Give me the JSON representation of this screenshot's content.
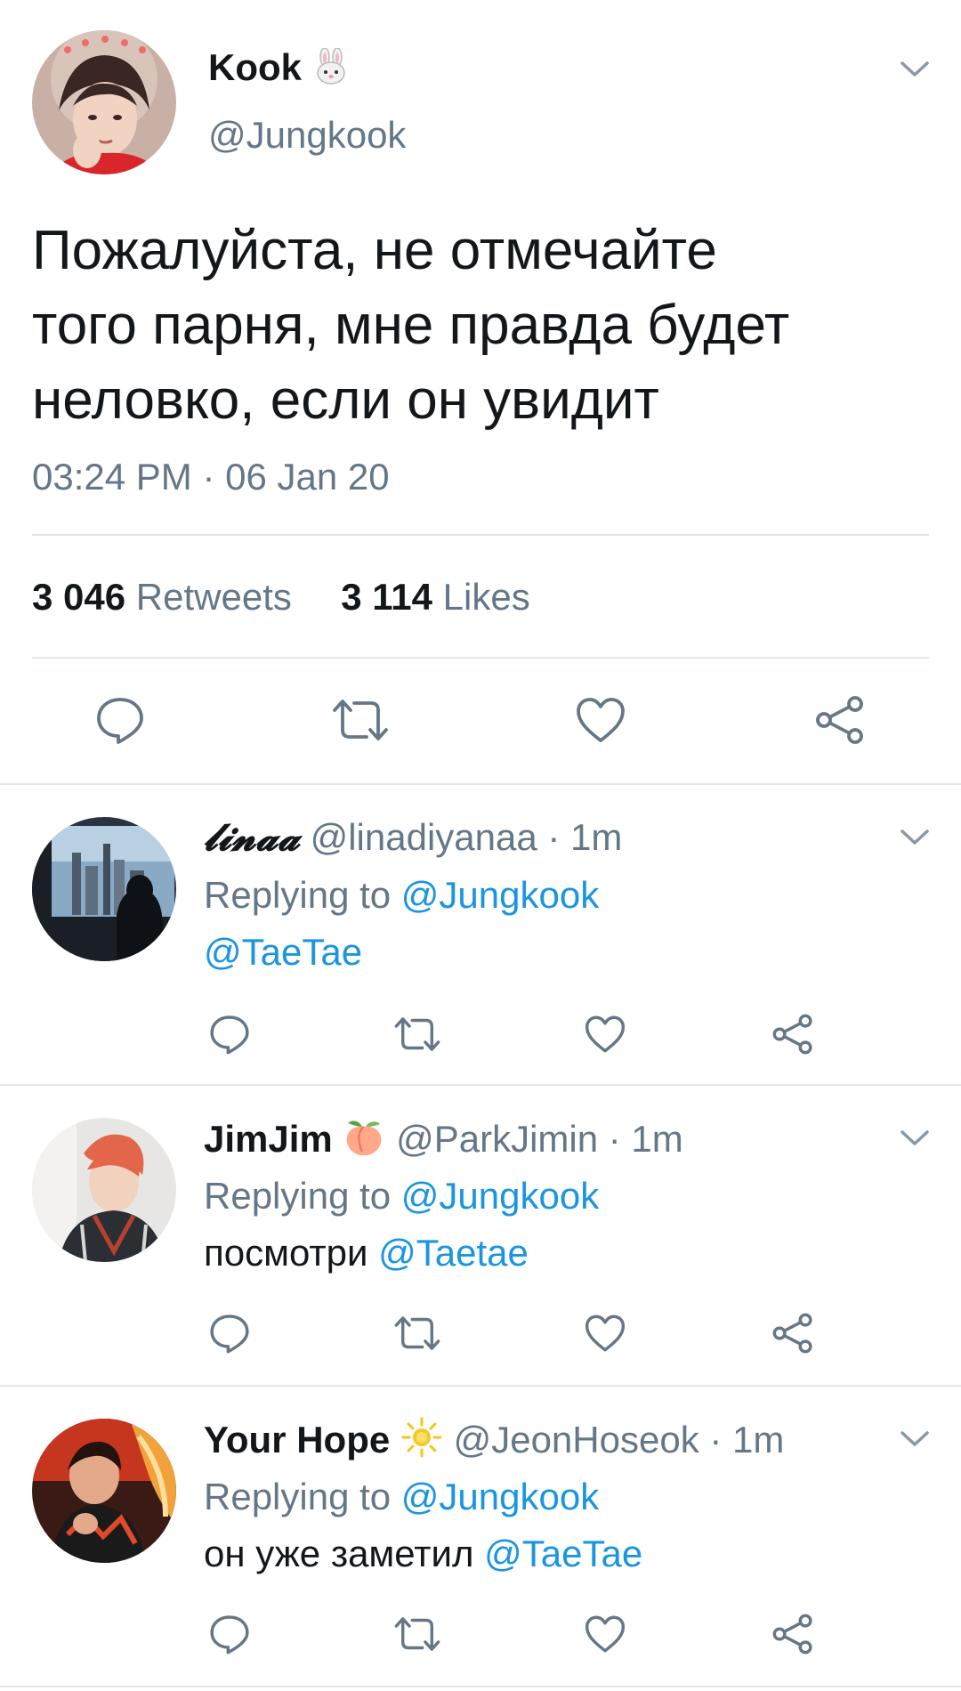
{
  "main_tweet": {
    "name": "Kook",
    "name_emoji": "rabbit-face-icon",
    "handle": "@Jungkook",
    "text": "Пожалуйста, не отмечайте\nтого парня, мне правда будет\nнеловко, если он увидит",
    "timestamp": "03:24 PM · 06 Jan 20",
    "retweets_count": "3 046",
    "retweets_label": "Retweets",
    "likes_count": "3 114",
    "likes_label": "Likes"
  },
  "replies": [
    {
      "name": "𝓵𝓲𝓷𝓪𝓪",
      "handle": "@linadiyanaa",
      "time": "· 1m",
      "replying_label": "Replying to",
      "replying_to": "@Jungkook",
      "text": "",
      "mention": "@TaeTae"
    },
    {
      "name": "JimJim",
      "name_emoji": "peach-icon",
      "handle": "@ParkJimin",
      "time": "· 1m",
      "replying_label": "Replying to",
      "replying_to": "@Jungkook",
      "text": "посмотри ",
      "mention": "@Taetae"
    },
    {
      "name": "Your Hope",
      "name_emoji": "sun-icon",
      "handle": "@JeonHoseok",
      "time": "· 1m",
      "replying_label": "Replying to",
      "replying_to": "@Jungkook",
      "text": "он уже заметил ",
      "mention": "@TaeTae"
    }
  ],
  "colors": {
    "text": "#14171a",
    "secondary": "#657786",
    "link": "#1b95e0",
    "divider": "#e1e8ed"
  }
}
